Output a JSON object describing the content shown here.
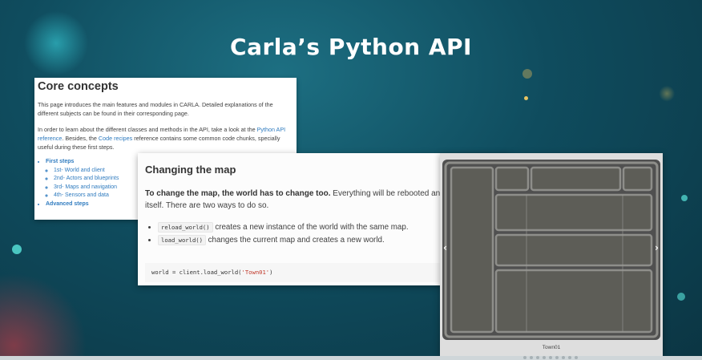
{
  "title": "Carla’s Python API",
  "core_concepts": {
    "heading": "Core concepts",
    "para1": "This page introduces the main features and modules in CARLA. Detailed explanations of the different subjects can be found in their corresponding page.",
    "para2_part1": "In order to learn about the different classes and methods in the API, take a look at the ",
    "para2_link1": "Python API reference",
    "para2_part2": ". Besides, the ",
    "para2_link2": "Code recipes",
    "para2_part3": " reference contains some common code chunks, specially useful during these first steps.",
    "toc": {
      "first_steps": "First steps",
      "sub": [
        "1st- World and client",
        "2nd- Actors and blueprints",
        "3rd- Maps and navigation",
        "4th- Sensors and data"
      ],
      "advanced_steps": "Advanced steps"
    }
  },
  "changing_map": {
    "heading": "Changing the map",
    "intro_bold": "To change the map, the world has to change too.",
    "intro_rest": " Everything will be rebooted and created from scratch, besides the Unreal Editor itself. There are two ways to do so.",
    "items": [
      {
        "code": "reload_world()",
        "text": " creates a new instance of the world with the same map."
      },
      {
        "code": "load_world()",
        "text": " changes the current map and creates a new world."
      }
    ],
    "code_prefix": "world = client.load_world(",
    "code_string": "'Town01'",
    "code_suffix": ")"
  },
  "map_viewer": {
    "caption": "Town01",
    "prev_label": "‹",
    "next_label": "›"
  },
  "colors": {
    "background": "#0f4c5e",
    "link": "#2f7bbf",
    "map_ground": "#5b5b55",
    "road": "#8e8e8a"
  }
}
